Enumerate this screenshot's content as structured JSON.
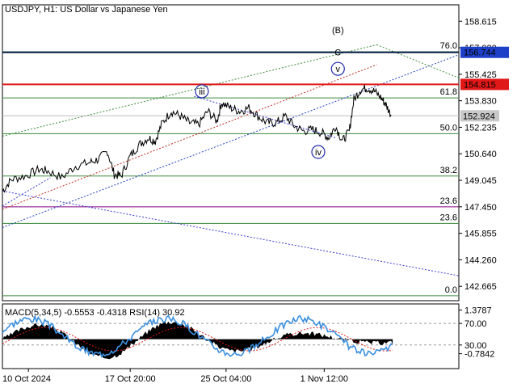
{
  "header": {
    "symbol": "USDJPY",
    "timeframe": "H1:",
    "description": "US Dollar vs Japanese Yen"
  },
  "chart_data": {
    "type": "line",
    "title": "USDJPY, H1:  US Dollar vs Japanese Yen",
    "ylim": [
      141.8,
      159.6
    ],
    "y_ticks": [
      "158.615",
      "157.020",
      "155.425",
      "153.830",
      "152.235",
      "150.640",
      "149.045",
      "147.450",
      "145.855",
      "144.260",
      "142.665"
    ],
    "x_ticks": [
      "10 Oct 2024",
      "17 Oct 20:00",
      "25 Oct 04:00",
      "1 Nov 12:00"
    ],
    "x_tick_pos": [
      0.057,
      0.28,
      0.49,
      0.705
    ],
    "price_path": [
      [
        0.0,
        148.4
      ],
      [
        0.02,
        149.1
      ],
      [
        0.05,
        149.3
      ],
      [
        0.08,
        149.7
      ],
      [
        0.1,
        149.6
      ],
      [
        0.13,
        149.2
      ],
      [
        0.16,
        149.9
      ],
      [
        0.19,
        150.1
      ],
      [
        0.21,
        150.3
      ],
      [
        0.23,
        150.8
      ],
      [
        0.245,
        149.4
      ],
      [
        0.26,
        149.3
      ],
      [
        0.28,
        150.5
      ],
      [
        0.3,
        151.2
      ],
      [
        0.32,
        151.6
      ],
      [
        0.335,
        151.4
      ],
      [
        0.35,
        152.5
      ],
      [
        0.37,
        153.2
      ],
      [
        0.39,
        152.9
      ],
      [
        0.41,
        152.5
      ],
      [
        0.43,
        152.4
      ],
      [
        0.45,
        153.2
      ],
      [
        0.47,
        152.6
      ],
      [
        0.48,
        153.7
      ],
      [
        0.5,
        153.4
      ],
      [
        0.52,
        153.2
      ],
      [
        0.54,
        153.4
      ],
      [
        0.56,
        152.9
      ],
      [
        0.58,
        152.5
      ],
      [
        0.6,
        152.5
      ],
      [
        0.62,
        152.9
      ],
      [
        0.64,
        152.3
      ],
      [
        0.66,
        152.0
      ],
      [
        0.68,
        152.1
      ],
      [
        0.7,
        151.9
      ],
      [
        0.715,
        151.6
      ],
      [
        0.73,
        152.3
      ],
      [
        0.745,
        151.4
      ],
      [
        0.76,
        152.0
      ],
      [
        0.77,
        153.9
      ],
      [
        0.785,
        154.5
      ],
      [
        0.8,
        154.6
      ],
      [
        0.815,
        154.4
      ],
      [
        0.83,
        154.0
      ],
      [
        0.84,
        153.6
      ],
      [
        0.852,
        152.95
      ]
    ],
    "current_price": "152.924",
    "current_value": 152.924,
    "horizontal_lines": [
      {
        "price": 156.744,
        "label": "156.744",
        "color": "#0b1f4b",
        "badge_bg": "#1e40c8"
      },
      {
        "price": 154.815,
        "label": "154.815",
        "color": "#e01818",
        "badge_bg": "#e01818"
      }
    ],
    "fib_levels": [
      {
        "label": "76.0",
        "price": 156.78,
        "color": "#3a8a3a"
      },
      {
        "label": "61.8",
        "price": 154.0,
        "color": "#3a8a3a"
      },
      {
        "label": "50.0",
        "price": 151.85,
        "color": "#3a8a3a"
      },
      {
        "label": "38.2",
        "price": 149.3,
        "color": "#3a8a3a"
      },
      {
        "label": "23.6",
        "price": 147.45,
        "color": "#800080"
      },
      {
        "label": "23.6",
        "price": 146.45,
        "color": "#3a8a3a"
      },
      {
        "label": "0.0",
        "price": 142.1,
        "color": "#3a8a3a"
      }
    ],
    "wave_labels": [
      {
        "text": "(B)",
        "x": 0.735,
        "price": 158.1,
        "color": "#3a8a3a",
        "circled": false
      },
      {
        "text": "C",
        "x": 0.735,
        "price": 156.75,
        "color": "#c0281e",
        "circled": false
      },
      {
        "text": "v",
        "x": 0.735,
        "price": 155.75,
        "color": "#1f2aa8",
        "circled": true
      },
      {
        "text": "iii",
        "x": 0.437,
        "price": 154.4,
        "color": "#1f2aa8",
        "circled": true
      },
      {
        "text": "iv",
        "x": 0.692,
        "price": 150.75,
        "color": "#1f2aa8",
        "circled": true
      }
    ],
    "indicator": {
      "label": "MACD(5,34,5) -0.5553 -0.4318 RSI(14) 30.92",
      "y_ticks": [
        "1.3787",
        "70.00",
        "30.00",
        "-0.7842"
      ]
    }
  }
}
